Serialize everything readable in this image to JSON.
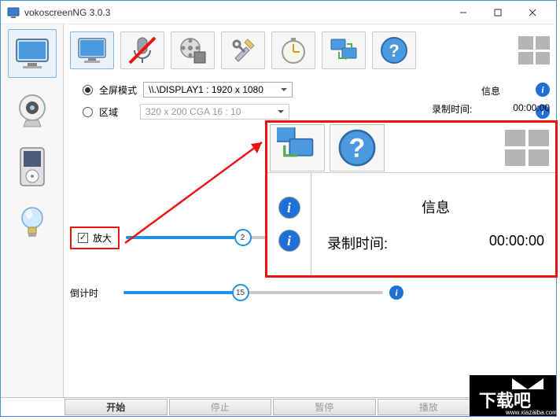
{
  "window": {
    "title": "vokoscreenNG 3.0.3"
  },
  "radios": {
    "fullscreen": {
      "label": "全屏模式",
      "display": "\\\\.\\DISPLAY1 :  1920 x 1080"
    },
    "region": {
      "label": "区域",
      "display": "320 x 200 CGA 16 : 10"
    }
  },
  "sidepanel": {
    "heading": "信息",
    "rec_label": "录制时间:",
    "rec_value": "00:00:00"
  },
  "magnify": {
    "label": "放大",
    "value": "2",
    "percent": 45
  },
  "countdown": {
    "label": "倒计时",
    "value": "15",
    "percent": 45
  },
  "zoom": {
    "heading": "信息",
    "rec_label": "录制时间:",
    "rec_value": "00:00:00"
  },
  "bottom": {
    "start": "开始",
    "stop": "停止",
    "pause": "暂停",
    "play": "播放"
  },
  "icons": {
    "monitor": "monitor",
    "webcam": "webcam",
    "media": "media",
    "bulb": "bulb"
  }
}
